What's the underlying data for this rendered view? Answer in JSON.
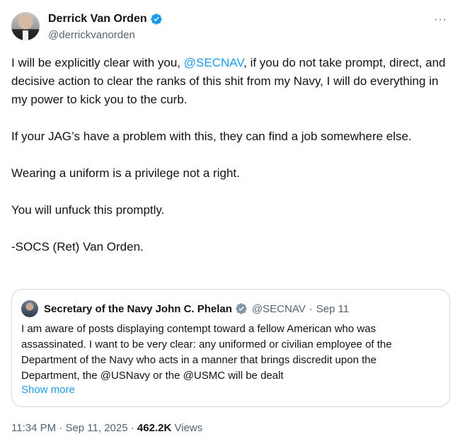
{
  "author": {
    "display_name": "Derrick Van Orden",
    "handle": "@derrickvanorden",
    "more_glyph": "···",
    "verified_color": "#1d9bf0"
  },
  "tweet": {
    "p1_before": "I will be explicitly clear with you, ",
    "p1_mention": "@SECNAV",
    "p1_after": ", if you do not take prompt, direct, and decisive action to clear the ranks of this shit from my Navy, I will do everything in my power to kick you to the curb.",
    "p2": "If your JAG’s have a problem with this, they can find a job somewhere else.",
    "p3": "Wearing a uniform is a privilege not a right.",
    "p4": "You will unfuck this promptly.",
    "p5": "-SOCS (Ret) Van Orden."
  },
  "quote": {
    "display_name": "Secretary of the Navy John C. Phelan",
    "handle": "@SECNAV",
    "separator": "·",
    "date": "Sep 11",
    "lines": [
      "I am aware of posts displaying contempt toward a fellow American who was",
      "assassinated. I want to be very clear: any uniformed or civilian employee of the",
      "Department of the Navy who acts in a manner that brings discredit upon the",
      "Department, the @USNavy or the @USMC will be dealt"
    ],
    "show_more": "Show more"
  },
  "meta": {
    "time": "11:34 PM",
    "sep1": " · ",
    "date": "Sep 11, 2025",
    "sep2": " · ",
    "views_count": "462.2K",
    "views_label": " Views"
  },
  "colors": {
    "link": "#1d9bf0",
    "secondary_text": "#536471",
    "border": "#cfd9de"
  }
}
